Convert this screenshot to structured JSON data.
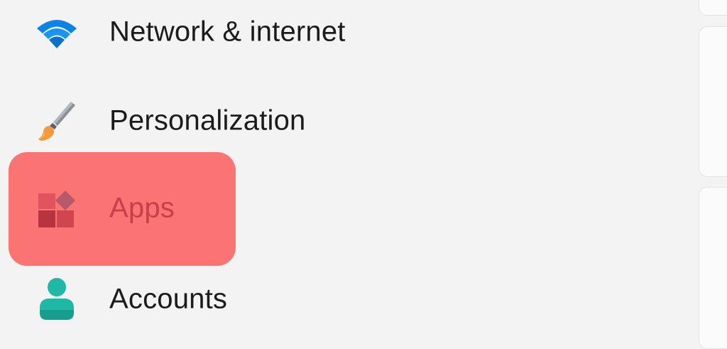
{
  "sidebar": {
    "items": [
      {
        "label": "Network & internet",
        "icon": "wifi-icon"
      },
      {
        "label": "Personalization",
        "icon": "paintbrush-icon"
      },
      {
        "label": "Apps",
        "icon": "apps-icon",
        "highlighted": true
      },
      {
        "label": "Accounts",
        "icon": "person-icon"
      }
    ]
  },
  "colors": {
    "background": "#f3f3f3",
    "highlight": "#fb7474",
    "wifi": "#0a84e6",
    "accounts": "#1fb8a6",
    "apps_label": "#c6404a"
  }
}
